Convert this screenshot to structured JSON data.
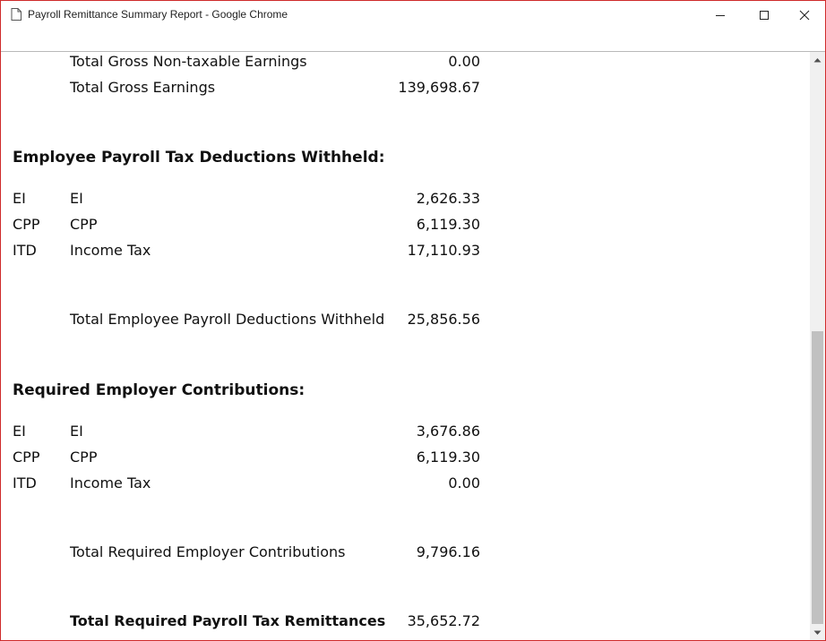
{
  "window": {
    "title": "Payroll Remittance Summary Report - Google Chrome"
  },
  "earnings": {
    "non_taxable": {
      "label": "Total Gross Non-taxable Earnings",
      "amount": "0.00"
    },
    "gross": {
      "label": "Total Gross Earnings",
      "amount": "139,698.67"
    }
  },
  "employee_deductions": {
    "heading": "Employee Payroll Tax Deductions Withheld:",
    "rows": [
      {
        "code": "EI",
        "desc": "EI",
        "amount": "2,626.33"
      },
      {
        "code": "CPP",
        "desc": "CPP",
        "amount": "6,119.30"
      },
      {
        "code": "ITD",
        "desc": "Income Tax",
        "amount": "17,110.93"
      }
    ],
    "total": {
      "label": "Total Employee Payroll Deductions Withheld",
      "amount": "25,856.56"
    }
  },
  "employer_contributions": {
    "heading": "Required Employer Contributions:",
    "rows": [
      {
        "code": "EI",
        "desc": "EI",
        "amount": "3,676.86"
      },
      {
        "code": "CPP",
        "desc": "CPP",
        "amount": "6,119.30"
      },
      {
        "code": "ITD",
        "desc": "Income Tax",
        "amount": "0.00"
      }
    ],
    "total": {
      "label": "Total Required Employer Contributions",
      "amount": "9,796.16"
    }
  },
  "grand_total": {
    "label": "Total Required Payroll Tax Remittances",
    "amount": "35,652.72"
  },
  "colors": {
    "window_border": "#cf2b2b",
    "scroll_thumb": "#c1c1c1",
    "scroll_track": "#f0f0f0"
  }
}
